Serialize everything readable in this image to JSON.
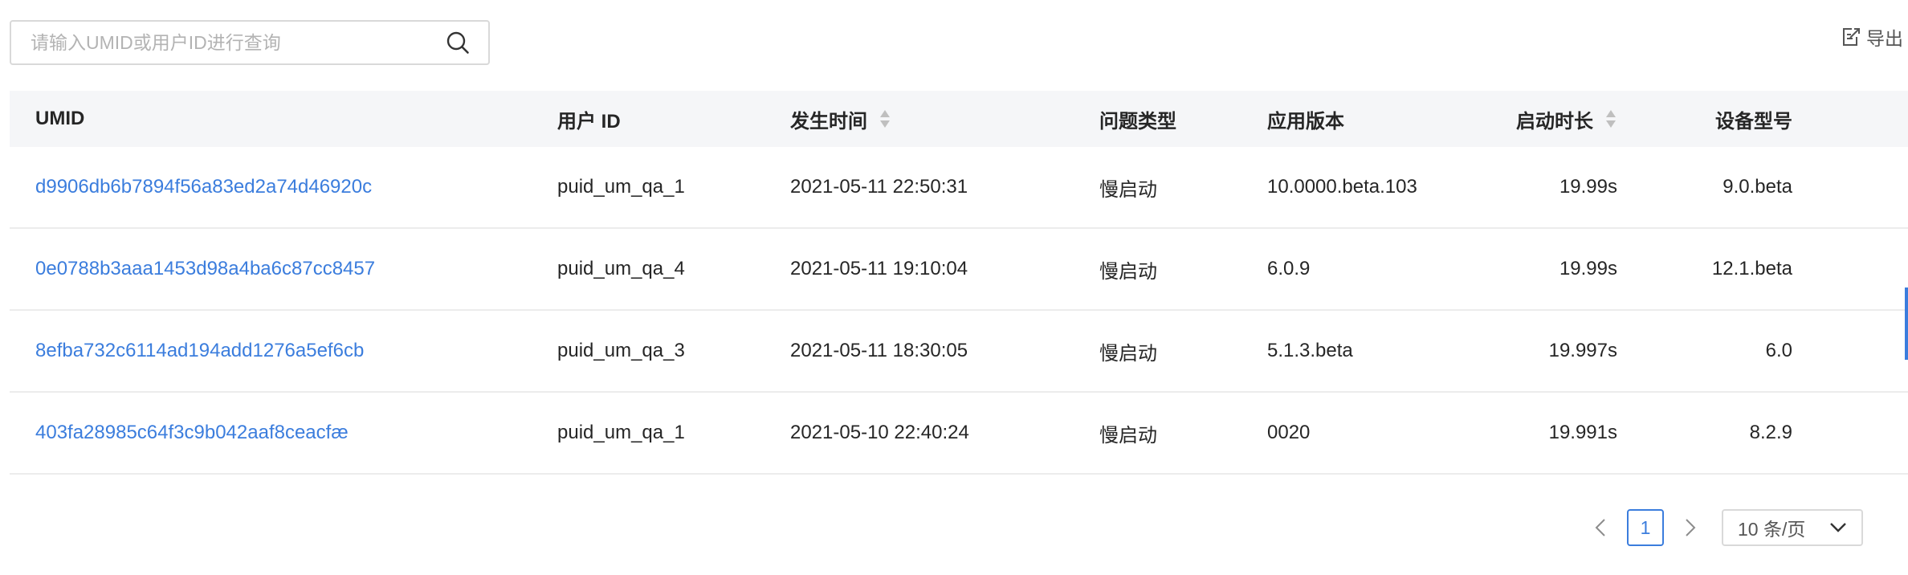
{
  "search": {
    "placeholder": "请输入UMID或用户ID进行查询",
    "value": ""
  },
  "toolbar": {
    "export_label": "导出"
  },
  "table": {
    "columns": {
      "umid": "UMID",
      "user_id": "用户 ID",
      "time": "发生时间",
      "issue_type": "问题类型",
      "app_version": "应用版本",
      "duration": "启动时长",
      "device_model": "设备型号"
    },
    "rows": [
      {
        "umid": "d9906db6b7894f56a83ed2a74d46920c",
        "user_id": "puid_um_qa_1",
        "time": "2021-05-11 22:50:31",
        "issue_type": "慢启动",
        "app_version": "10.0000.beta.103",
        "duration": "19.99s",
        "device_model": "9.0.beta"
      },
      {
        "umid": "0e0788b3aaa1453d98a4ba6c87cc8457",
        "user_id": "puid_um_qa_4",
        "time": "2021-05-11 19:10:04",
        "issue_type": "慢启动",
        "app_version": "6.0.9",
        "duration": "19.99s",
        "device_model": "12.1.beta"
      },
      {
        "umid": "8efba732c6114ad194add1276a5ef6cb",
        "user_id": "puid_um_qa_3",
        "time": "2021-05-11 18:30:05",
        "issue_type": "慢启动",
        "app_version": "5.1.3.beta",
        "duration": "19.997s",
        "device_model": "6.0"
      },
      {
        "umid": "403fa28985c64f3c9b042aaf8ceacfæ",
        "user_id": "puid_um_qa_1",
        "time": "2021-05-10 22:40:24",
        "issue_type": "慢启动",
        "app_version": "0020",
        "duration": "19.991s",
        "device_model": "8.2.9"
      }
    ]
  },
  "pagination": {
    "current_page": "1",
    "page_size_label": "10 条/页"
  },
  "colors": {
    "accent": "#3b7ddd",
    "header_bg": "#f5f6f8",
    "border": "#d9d9d9"
  },
  "icons": {
    "search": "search-icon",
    "export": "export-icon",
    "sort": "sort-icon",
    "prev": "chevron-left-icon",
    "next": "chevron-right-icon",
    "dropdown": "chevron-down-icon"
  }
}
